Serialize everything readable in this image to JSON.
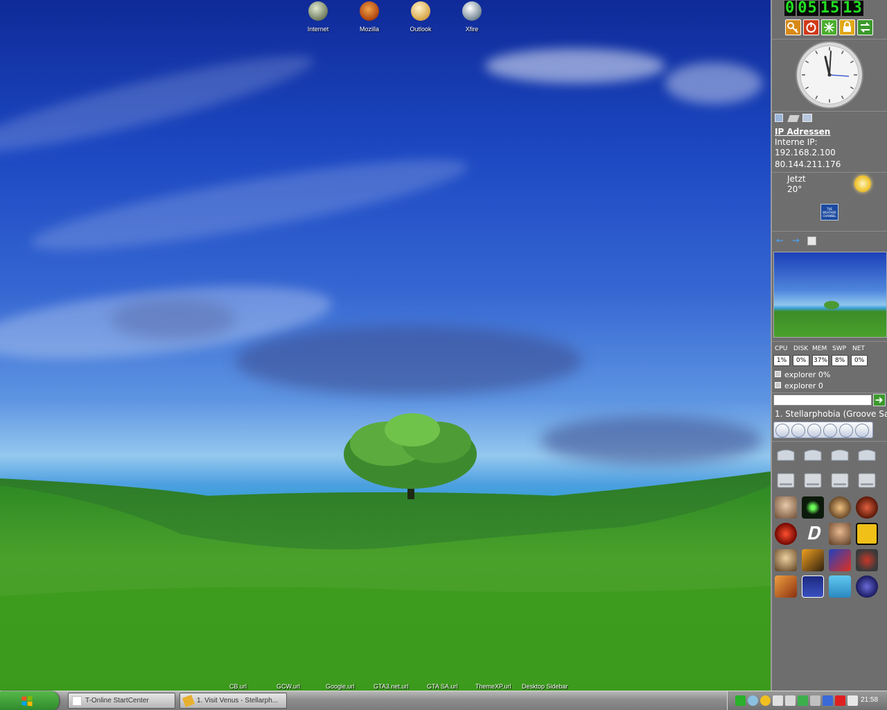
{
  "desktop": {
    "icons": [
      {
        "label": "Internet"
      },
      {
        "label": "Mozilla"
      },
      {
        "label": "Outlook"
      },
      {
        "label": "Xfire"
      }
    ],
    "bottom_links": [
      "CB.url",
      "GCW.url",
      "Google.url",
      "GTA3.net.url",
      "GTA SA.url",
      "ThemeXP.url",
      "Desktop Sidebar"
    ]
  },
  "sidebar": {
    "clock_digits": [
      "0",
      "05",
      "15",
      "13"
    ],
    "ip_title": "IP Adressen",
    "ip_lines": [
      "Interne IP:",
      "192.168.2.100",
      "80.144.211.176"
    ],
    "weather": {
      "now_label": "Jetzt",
      "temp": "20°",
      "channel_badge": "THE WEATHER CHANNEL"
    },
    "perf_headers": [
      "CPU",
      "DISK",
      "MEM",
      "SWP",
      "NET"
    ],
    "perf_values": [
      "1%",
      "0%",
      "37%",
      "8%",
      "0%"
    ],
    "processes": [
      "explorer 0%",
      "explorer 0"
    ],
    "search": {
      "value": ""
    },
    "media": {
      "track": "1. Stellarphobia (Groove Sa"
    }
  },
  "taskbar": {
    "tasks": [
      "T-Online StartCenter",
      "1. Visit Venus - Stellarph..."
    ],
    "time": "21:58"
  },
  "colors": {
    "sidebar_bg": "#6e6e6e",
    "digital_green": "#22e022",
    "start_green": "#3c9a2c"
  }
}
